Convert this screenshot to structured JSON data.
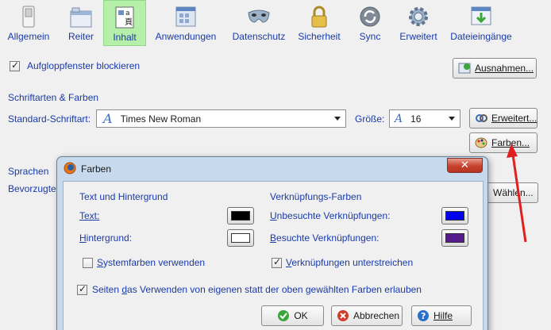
{
  "toolbar": {
    "items": [
      {
        "label": "Allgemein",
        "icon": "general-switch-icon"
      },
      {
        "label": "Reiter",
        "icon": "tabs-window-icon"
      },
      {
        "label": "Inhalt",
        "icon": "content-page-icon",
        "active": true
      },
      {
        "label": "Anwendungen",
        "icon": "applications-icon"
      },
      {
        "label": "Datenschutz",
        "icon": "privacy-mask-icon"
      },
      {
        "label": "Sicherheit",
        "icon": "security-lock-icon"
      },
      {
        "label": "Sync",
        "icon": "sync-icon"
      },
      {
        "label": "Erweitert",
        "icon": "advanced-gear-icon"
      },
      {
        "label": "Dateieingänge",
        "icon": "downloads-icon"
      }
    ]
  },
  "content": {
    "popup_block_label": "Aufgloppfenster blockieren",
    "popup_block_checked": true,
    "exceptions_button": "Ausnahmen...",
    "fonts_heading": "Schriftarten & Farben",
    "default_font_label": "Standard-Schriftart:",
    "default_font_value": "Times New Roman",
    "size_label": "Größe:",
    "size_value": "16",
    "advanced_button": "Erweitert...",
    "colors_button": "Farben...",
    "languages_heading": "Sprachen",
    "preferred_label": "Bevorzugte",
    "choose_button": "Wählen..."
  },
  "dialog": {
    "title": "Farben",
    "close_symbol": "✕",
    "text_bg_heading": "Text und Hintergrund",
    "text_label": "Text:",
    "text_color": "#000000",
    "background_label": "Hintergrund:",
    "background_color": "#ffffff",
    "system_colors_label": "Systemfarben verwenden",
    "system_colors_checked": false,
    "link_colors_heading": "Verknüpfungs-Farben",
    "unvisited_label": "Unbesuchte Verknüpfungen:",
    "unvisited_color": "#0000ee",
    "visited_label": "Besuchte Verknüpfungen:",
    "visited_color": "#551a8b",
    "underline_links_label": "Verknüpfungen unterstreichen",
    "underline_links_checked": true,
    "allow_page_colors_label": "Seiten das Verwenden von eigenen statt der oben gewählten Farben erlauben",
    "allow_page_colors_checked": true,
    "ok_button": "OK",
    "cancel_button": "Abbrechen",
    "help_button": "Hilfe"
  },
  "colors": {
    "accent_blue": "#1a3aa8",
    "active_tab_green": "#b5efa9",
    "annotation_arrow": "#e02020"
  }
}
